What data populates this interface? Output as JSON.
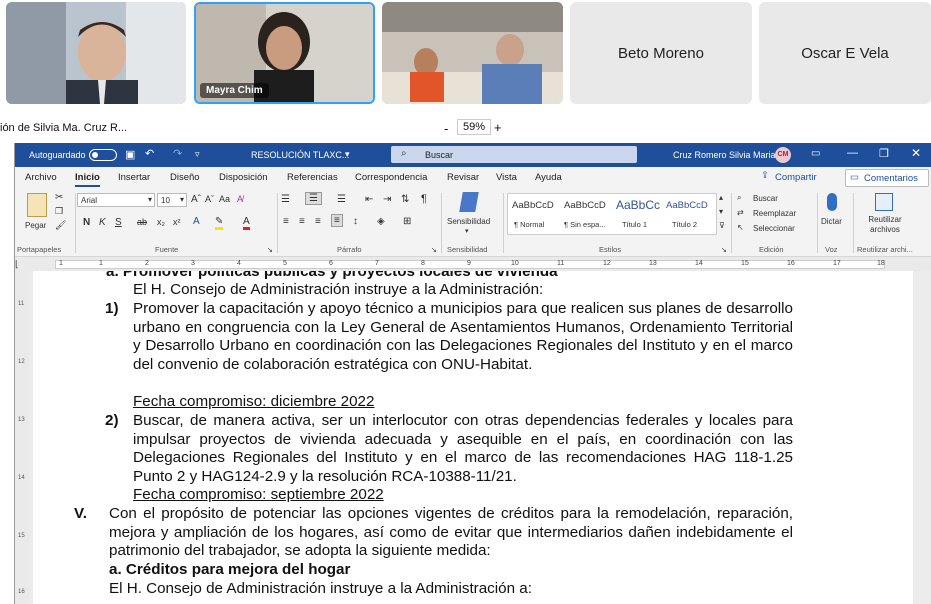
{
  "participants": [
    {
      "name": ""
    },
    {
      "name": "Mayra Chim"
    },
    {
      "name": ""
    },
    {
      "name": "Beto Moreno"
    },
    {
      "name": "Oscar E Vela"
    }
  ],
  "share": {
    "presenter": "ión de Silvia Ma. Cruz R...",
    "zoom": "59%",
    "minus": "-",
    "plus": "+"
  },
  "word": {
    "autosave": "Autoguardado",
    "doc_title": "RESOLUCIÓN TLAXC...",
    "search": "Buscar",
    "user": "Cruz Romero Silvia Maria",
    "user_initials": "CM",
    "tabs": [
      "Archivo",
      "Inicio",
      "Insertar",
      "Diseño",
      "Disposición",
      "Referencias",
      "Correspondencia",
      "Revisar",
      "Vista",
      "Ayuda"
    ],
    "share_btn": "Compartir",
    "comments_btn": "Comentarios",
    "ribbon": {
      "paste": "Pegar",
      "font": "Arial",
      "size": "10",
      "sensitivity": "Sensibilidad",
      "styles": [
        "AaBbCcD",
        "AaBbCcD",
        "AaBbCc",
        "AaBbCcD"
      ],
      "style_names": [
        "¶ Normal",
        "¶ Sin espa...",
        "Título 1",
        "Título 2"
      ],
      "find": "Buscar",
      "replace": "Reemplazar",
      "select": "Seleccionar",
      "dictate": "Dictar",
      "reuse": "Reutilizar archivos",
      "groups": [
        "Portapapeles",
        "Fuente",
        "Párrafo",
        "Sensibilidad",
        "Estilos",
        "Edición",
        "Voz",
        "Reutilizar archi..."
      ]
    },
    "ruler_nums": [
      "1",
      "1",
      "2",
      "3",
      "4",
      "5",
      "6",
      "7",
      "8",
      "9",
      "10",
      "11",
      "12",
      "13",
      "14",
      "15",
      "16",
      "17",
      "18"
    ]
  },
  "document": {
    "heading_a": "a.  Promover políticas públicas y proyectos locales de vivienda",
    "instructs": "El H. Consejo de Administración instruye a la Administración:",
    "item1_num": "1)",
    "item1_text": "Promover la capacitación y apoyo técnico a municipios para que realicen sus planes de desarrollo urbano en congruencia con la Ley General de Asentamientos Humanos, Ordenamiento Territorial y Desarrollo Urbano en coordinación con las Delegaciones Regionales del Instituto y en el marco del convenio de colaboración estratégica con ONU-Habitat.",
    "item1_date": "Fecha compromiso: diciembre 2022",
    "item2_num": "2)",
    "item2_text": "Buscar, de manera activa, ser un interlocutor con otras dependencias federales y locales para impulsar proyectos de vivienda adecuada y asequible en el país, en coordinación con las Delegaciones Regionales del Instituto y en el marco de las recomendaciones HAG 118-1.25 Punto 2 y HAG124-2.9 y la resolución RCA-10388-11/21.",
    "item2_date": "Fecha compromiso: septiembre 2022",
    "roman_v": "V.",
    "para_v": "Con el propósito de potenciar las opciones vigentes de créditos para la remodelación, reparación, mejora y ampliación de los hogares, así como de evitar que intermediarios dañen indebidamente el patrimonio del trabajador, se adopta la siguiente medida:",
    "heading_va": "a.  Créditos para mejora del hogar",
    "instructs_a": "El H. Consejo de Administración instruye a la Administración a:"
  },
  "vruler": [
    "11",
    "12",
    "13",
    "14",
    "15",
    "16"
  ]
}
